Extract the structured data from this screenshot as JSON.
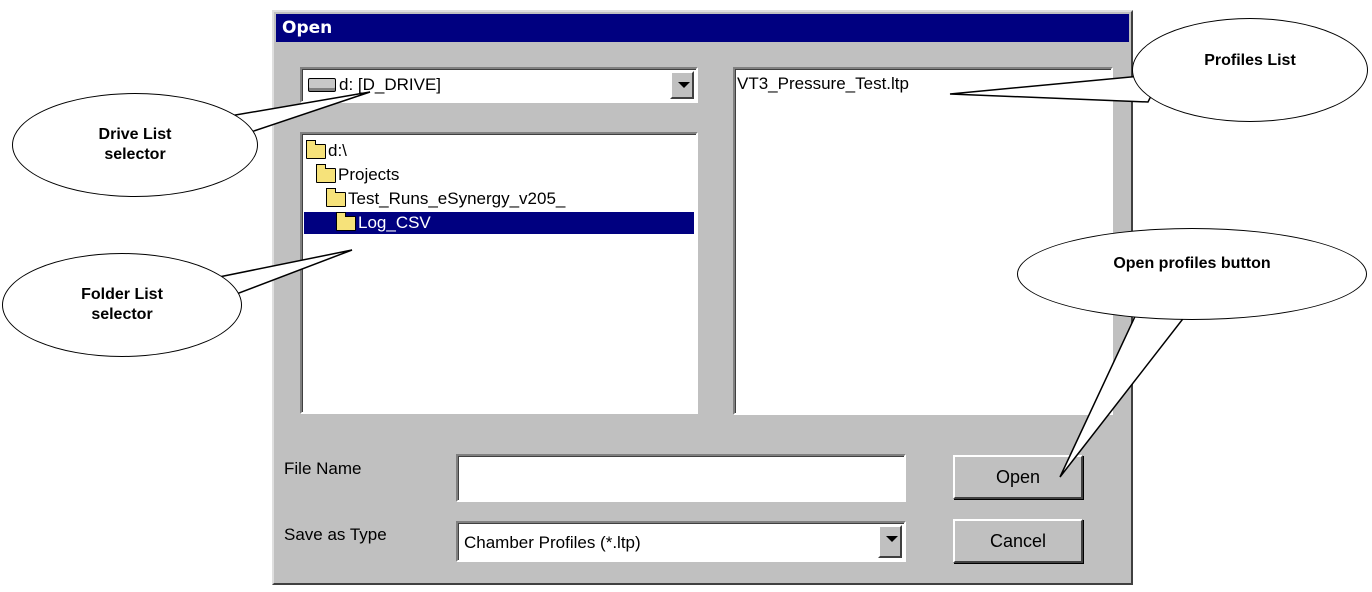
{
  "dialog": {
    "title": "Open",
    "drive_select": {
      "value": "d: [D_DRIVE]",
      "icon": "drive-icon"
    },
    "folders": [
      {
        "label": "d:\\",
        "selected": false
      },
      {
        "label": "Projects",
        "selected": false
      },
      {
        "label": "Test_Runs_eSynergy_v205_",
        "selected": false
      },
      {
        "label": "Log_CSV",
        "selected": true
      }
    ],
    "files": [
      "VT3_Pressure_Test.ltp"
    ],
    "file_name_label": "File Name",
    "file_name_value": "",
    "type_label": "Save as Type",
    "type_value": "Chamber Profiles (*.ltp)",
    "open_button": "Open",
    "cancel_button": "Cancel"
  },
  "callouts": {
    "drive_list": "Drive List selector",
    "folder_list": "Folder List selector",
    "profiles_list": "Profiles List",
    "open_profiles": "Open profiles button"
  },
  "colors": {
    "titlebar": "#000080",
    "dialog_face": "#c0c0c0",
    "selection": "#000080"
  }
}
